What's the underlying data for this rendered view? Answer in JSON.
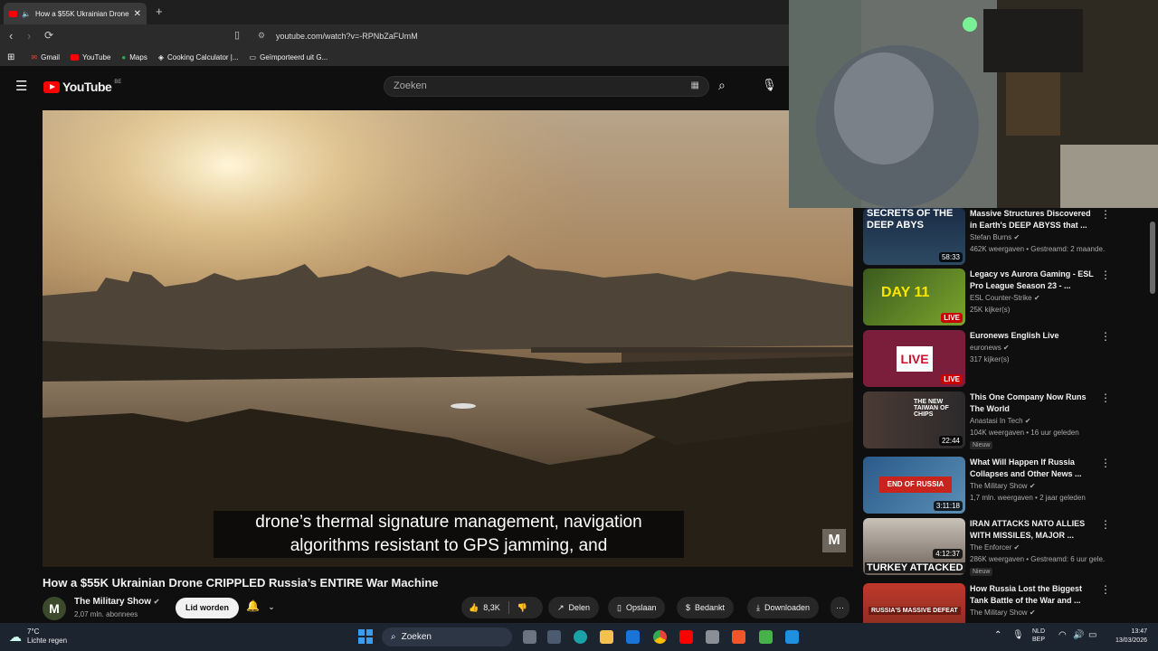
{
  "browser": {
    "tab_title": "How a $55K Ukrainian Drone",
    "url": "youtube.com/watch?v=-RPNbZaFUmM",
    "bookmarks": [
      "Gmail",
      "YouTube",
      "Maps",
      "Cooking Calculator |...",
      "Geïmporteerd uit G..."
    ]
  },
  "youtube": {
    "logo_text": "YouTube",
    "region_code": "BE",
    "search_placeholder": "Zoeken"
  },
  "video": {
    "caption_line1": "drone’s thermal signature management, navigation",
    "caption_line2": "algorithms resistant to GPS jamming, and",
    "watermark": "M",
    "title": "How a $55K Ukrainian Drone CRIPPLED Russia’s ENTIRE War Machine"
  },
  "channel": {
    "avatar_letter": "M",
    "name": "The Military Show",
    "subscribers": "2,07 mln. abonnees",
    "join_label": "Lid worden"
  },
  "actions": {
    "likes": "8,3K",
    "share": "Delen",
    "save": "Opslaan",
    "thanks": "Bedankt",
    "download": "Downloaden"
  },
  "recommendations": [
    {
      "title": "Massive Structures Discovered in Earth's DEEP ABYSS that ...",
      "channel": "Stefan Burns",
      "meta": "462K weergaven • Gestreamd: 2 maande...",
      "badge": "58:33",
      "badge_type": "duration",
      "thumb_text": "SECRETS OF THE DEEP ABYS"
    },
    {
      "title": "Legacy vs Aurora Gaming - ESL Pro League Season 23 - ...",
      "channel": "ESL Counter-Strike",
      "meta": "25K kijker(s)",
      "badge": "LIVE",
      "badge_type": "live",
      "thumb_text": "DAY 11"
    },
    {
      "title": "Euronews English Live",
      "channel": "euronews",
      "meta": "317 kijker(s)",
      "badge": "LIVE",
      "badge_type": "live",
      "thumb_text": "LIVE"
    },
    {
      "title": "This One Company Now Runs The World",
      "channel": "Anastasi In Tech",
      "meta": "104K weergaven • 16 uur geleden",
      "badge": "22:44",
      "badge_type": "duration",
      "thumb_text": "THE NEW TAIWAN OF CHIPS",
      "new_label": "Nieuw"
    },
    {
      "title": "What Will Happen If Russia Collapses and Other News ...",
      "channel": "The Military Show",
      "meta": "1,7 mln. weergaven • 2 jaar geleden",
      "badge": "3:11:18",
      "badge_type": "duration",
      "thumb_text": "END OF RUSSIA"
    },
    {
      "title": "IRAN ATTACKS NATO ALLIES WITH MISSILES, MAJOR ...",
      "channel": "The Enforcer",
      "meta": "286K weergaven • Gestreamd: 6 uur gele...",
      "badge": "4:12:37",
      "badge_type": "duration",
      "thumb_text": "TURKEY ATTACKED",
      "new_label": "Nieuw"
    },
    {
      "title": "How Russia Lost the Biggest Tank Battle of the War and ...",
      "channel": "The Military Show",
      "meta": "",
      "badge": "",
      "badge_type": "none",
      "thumb_text": "RUSSIA'S MASSIVE DEFEAT"
    }
  ],
  "taskbar": {
    "weather_temp": "7°C",
    "weather_desc": "Lichte regen",
    "search_label": "Zoeken",
    "lang_line1": "NLD",
    "lang_line2": "BEP",
    "time": "13:47",
    "date": "13/03/2026"
  }
}
